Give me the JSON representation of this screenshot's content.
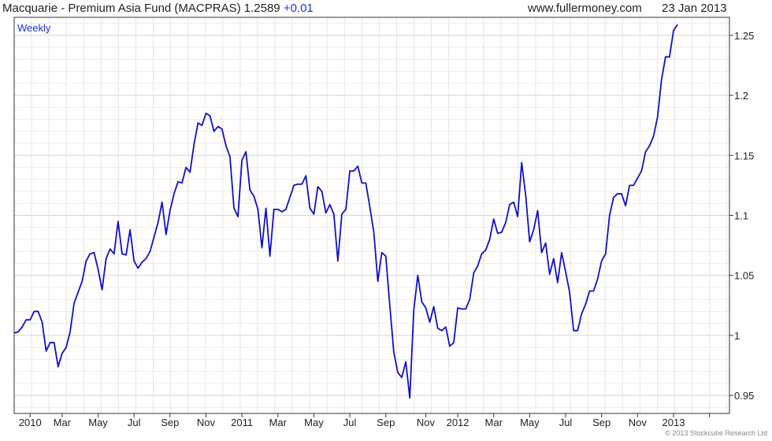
{
  "header": {
    "title": "Macquarie - Premium Asia Fund (MACPRAS) 1.2589",
    "change": "+0.01",
    "site": "www.fullermoney.com",
    "date": "23 Jan 2013"
  },
  "footer": {
    "credit": "© 2013 Stockcube Research Ltd"
  },
  "colors": {
    "line": "#1010c8",
    "grid": "#dcdcdc",
    "frame": "#333333",
    "period_label": "#2233cc"
  },
  "chart_data": {
    "type": "line",
    "period_label": "Weekly",
    "ylim": [
      0.935,
      1.265
    ],
    "yticks": [
      0.95,
      1.0,
      1.05,
      1.1,
      1.15,
      1.2,
      1.25
    ],
    "ytick_labels": [
      "0.95",
      "1",
      "1.05",
      "1.1",
      "1.15",
      "1.2",
      "1.25"
    ],
    "xlim": [
      0,
      179
    ],
    "xticks": [
      4,
      12,
      21,
      30,
      39,
      48,
      57,
      66,
      75,
      84,
      93,
      103,
      111,
      120,
      129,
      138,
      147,
      156,
      165,
      174
    ],
    "xtick_labels": [
      "2010",
      "Mar",
      "May",
      "Jul",
      "Sep",
      "Nov",
      "2011",
      "Mar",
      "May",
      "Jul",
      "Sep",
      "Nov",
      "2012",
      "Mar",
      "May",
      "Jul",
      "Sep",
      "Nov",
      "2013",
      ""
    ],
    "grid": true,
    "series": [
      {
        "values": [
          1.002,
          1.003,
          1.007,
          1.013,
          1.013,
          1.02,
          1.02,
          1.011,
          0.987,
          0.994,
          0.994,
          0.974,
          0.985,
          0.99,
          1.003,
          1.027,
          1.036,
          1.045,
          1.062,
          1.068,
          1.069,
          1.055,
          1.038,
          1.064,
          1.072,
          1.068,
          1.095,
          1.068,
          1.067,
          1.088,
          1.062,
          1.056,
          1.061,
          1.064,
          1.07,
          1.082,
          1.094,
          1.111,
          1.084,
          1.104,
          1.118,
          1.128,
          1.127,
          1.14,
          1.136,
          1.159,
          1.177,
          1.175,
          1.185,
          1.183,
          1.17,
          1.174,
          1.172,
          1.158,
          1.149,
          1.106,
          1.099,
          1.146,
          1.153,
          1.121,
          1.116,
          1.105,
          1.073,
          1.106,
          1.066,
          1.105,
          1.105,
          1.103,
          1.105,
          1.115,
          1.125,
          1.126,
          1.126,
          1.133,
          1.106,
          1.101,
          1.124,
          1.12,
          1.102,
          1.109,
          1.101,
          1.062,
          1.101,
          1.105,
          1.137,
          1.137,
          1.141,
          1.127,
          1.127,
          1.107,
          1.086,
          1.045,
          1.069,
          1.066,
          1.025,
          0.986,
          0.969,
          0.965,
          0.978,
          0.948,
          1.021,
          1.05,
          1.028,
          1.023,
          1.011,
          1.024,
          1.006,
          1.004,
          1.007,
          0.991,
          0.994,
          1.023,
          1.022,
          1.022,
          1.03,
          1.052,
          1.058,
          1.068,
          1.071,
          1.08,
          1.097,
          1.085,
          1.086,
          1.094,
          1.109,
          1.111,
          1.099,
          1.144,
          1.117,
          1.078,
          1.088,
          1.104,
          1.069,
          1.077,
          1.051,
          1.064,
          1.044,
          1.069,
          1.053,
          1.036,
          1.004,
          1.004,
          1.018,
          1.026,
          1.037,
          1.037,
          1.047,
          1.062,
          1.068,
          1.1,
          1.115,
          1.118,
          1.118,
          1.108,
          1.125,
          1.125,
          1.131,
          1.137,
          1.153,
          1.158,
          1.166,
          1.182,
          1.213,
          1.232,
          1.232,
          1.254,
          1.259
        ]
      }
    ]
  }
}
